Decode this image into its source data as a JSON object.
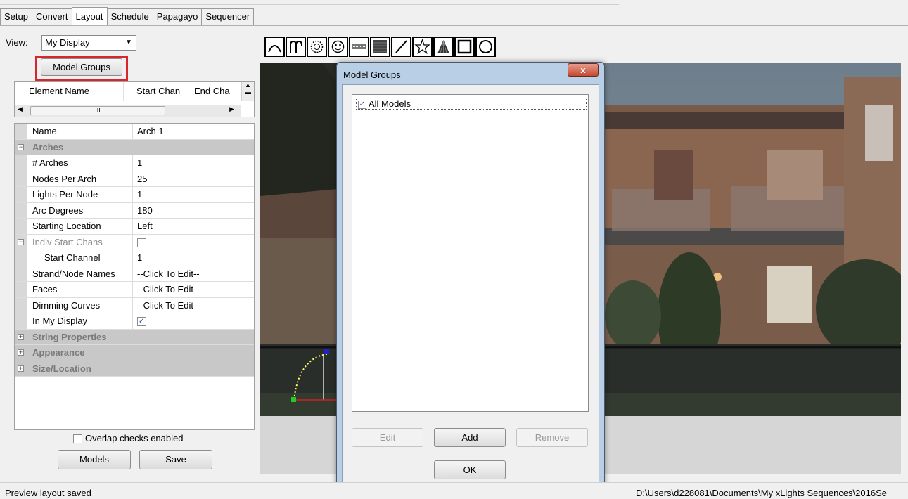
{
  "tabs": [
    {
      "label": "Setup",
      "active": false
    },
    {
      "label": "Convert",
      "active": false
    },
    {
      "label": "Layout",
      "active": true
    },
    {
      "label": "Schedule",
      "active": false
    },
    {
      "label": "Papagayo",
      "active": false
    },
    {
      "label": "Sequencer",
      "active": false
    }
  ],
  "left_panel": {
    "view_label": "View:",
    "view_selected": "My Display",
    "model_groups_button": "Model Groups",
    "element_list": {
      "columns": [
        "Element Name",
        "Start Chan",
        "End Cha"
      ],
      "hscroll_grip": "III"
    },
    "properties": {
      "name_label": "Name",
      "name_value": "Arch 1",
      "cat_arches": "Arches",
      "arches_label": "# Arches",
      "arches_value": "1",
      "nodes_label": "Nodes Per Arch",
      "nodes_value": "25",
      "lights_label": "Lights Per Node",
      "lights_value": "1",
      "arc_label": "Arc Degrees",
      "arc_value": "180",
      "startloc_label": "Starting Location",
      "startloc_value": "Left",
      "indiv_label": "Indiv Start Chans",
      "startchan_label": "Start Channel",
      "startchan_value": "1",
      "strand_label": "Strand/Node Names",
      "strand_value": "--Click To Edit--",
      "faces_label": "Faces",
      "faces_value": "--Click To Edit--",
      "dimming_label": "Dimming Curves",
      "dimming_value": "--Click To Edit--",
      "inmydisplay_label": "In My Display",
      "cat_string": "String Properties",
      "cat_appearance": "Appearance",
      "cat_size": "Size/Location"
    },
    "overlap_label": "Overlap checks enabled",
    "models_button": "Models",
    "save_button": "Save"
  },
  "toolbar_icons": [
    "arches-icon",
    "candy-canes-icon",
    "circle-icon",
    "custom-model-icon",
    "single-line-matrix-icon",
    "matrix-icon",
    "line-icon",
    "star-icon",
    "tree-icon",
    "window-frame-icon",
    "wreath-icon"
  ],
  "dialog": {
    "title": "Model Groups",
    "close_glyph": "x",
    "items": [
      {
        "label": "All Models",
        "checked": true
      }
    ],
    "edit_button": "Edit",
    "add_button": "Add",
    "remove_button": "Remove",
    "ok_button": "OK"
  },
  "status": {
    "left": "Preview layout saved",
    "right": "D:\\Users\\d228081\\Documents\\My xLights Sequences\\2016Se"
  },
  "colors": {
    "highlight_red": "#d8262c",
    "dialog_frame": "#b9cfe6",
    "close_red": "#c54a32",
    "category_gray": "#c8c8c8"
  }
}
